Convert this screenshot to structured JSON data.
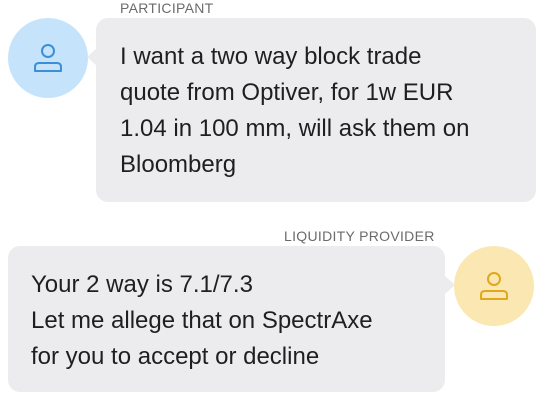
{
  "colors": {
    "participant_avatar_bg": "#c5e4fb",
    "participant_icon": "#3b8fd6",
    "provider_avatar_bg": "#fbe7b2",
    "provider_icon": "#e0a81c",
    "bubble_bg": "#ececef"
  },
  "messages": [
    {
      "sender": "PARTICIPANT",
      "avatar_icon": "user-icon",
      "lines": [
        "I want a two way block trade",
        "quote from Optiver, for 1w EUR",
        "1.04 in 100 mm, will ask them on",
        "Bloomberg"
      ]
    },
    {
      "sender": "LIQUIDITY PROVIDER",
      "avatar_icon": "user-icon",
      "lines": [
        "Your 2 way is 7.1/7.3",
        "Let me allege that on SpectrAxe",
        "for you to accept or decline"
      ]
    }
  ]
}
